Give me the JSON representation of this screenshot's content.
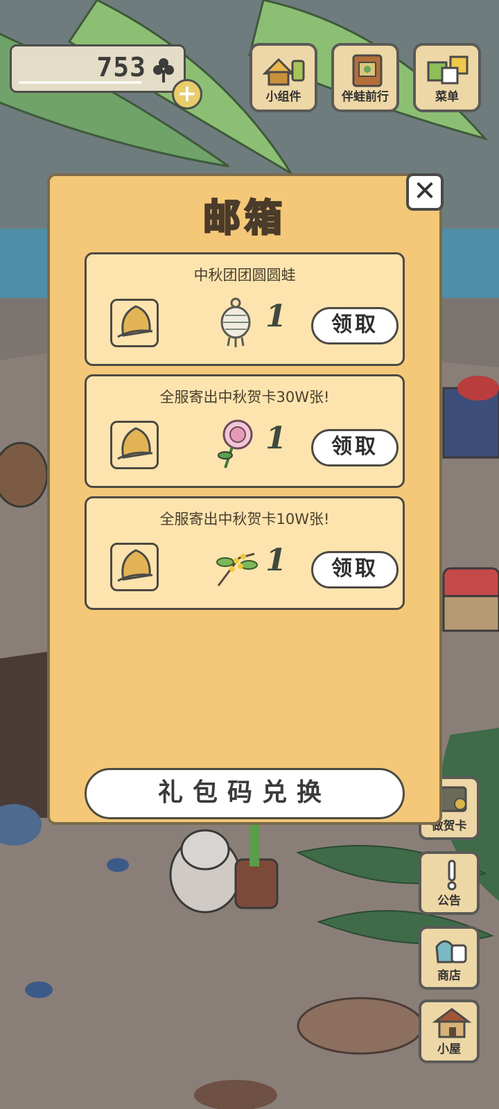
{
  "hud": {
    "clovers": "753",
    "top_buttons": [
      {
        "label": "小组件",
        "icon": "widget-icon"
      },
      {
        "label": "伴蛙前行",
        "icon": "journey-book-icon"
      },
      {
        "label": "菜单",
        "icon": "menu-icon"
      }
    ],
    "side_buttons": [
      {
        "label": "做贺卡",
        "icon": "greeting-card-icon"
      },
      {
        "label": "公告",
        "icon": "notice-icon"
      },
      {
        "label": "商店",
        "icon": "shop-icon"
      },
      {
        "label": "小屋",
        "icon": "house-icon"
      }
    ]
  },
  "mailbox": {
    "title": "邮箱",
    "close_symbol": "✕",
    "items": [
      {
        "title": "中秋团团圆圆蛙",
        "reward_icon": "lantern-charm-icon",
        "quantity": "1",
        "claim_label": "领取"
      },
      {
        "title": "全服寄出中秋贺卡30W张!",
        "reward_icon": "peony-flower-icon",
        "quantity": "1",
        "claim_label": "领取"
      },
      {
        "title": "全服寄出中秋贺卡10W张!",
        "reward_icon": "osmanthus-sprig-icon",
        "quantity": "1",
        "claim_label": "领取"
      }
    ],
    "redeem_label": "礼包码兑换"
  },
  "colors": {
    "panel": "#f4c878",
    "item_bg": "#fde4ae",
    "button_wood": "#eed7a6",
    "outline": "#4d4a43"
  }
}
